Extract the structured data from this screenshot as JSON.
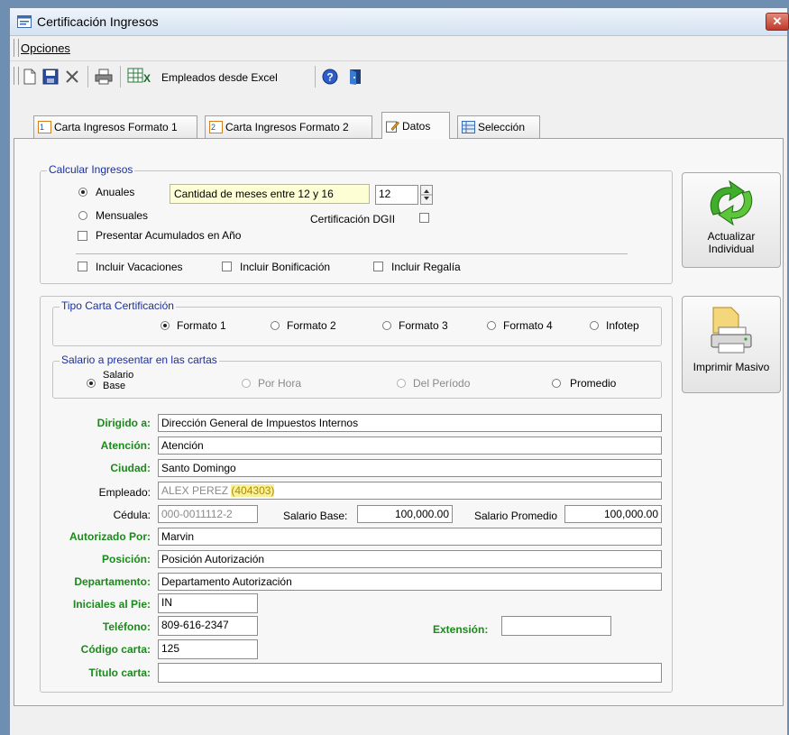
{
  "window": {
    "title": "Certificación Ingresos"
  },
  "menu": {
    "opciones": "Opciones"
  },
  "toolbar": {
    "excel_label": "Empleados desde Excel"
  },
  "tabs": [
    {
      "label": "Carta Ingresos Formato 1"
    },
    {
      "label": "Carta Ingresos Formato 2"
    },
    {
      "label": "Datos",
      "active": true
    },
    {
      "label": "Selección"
    }
  ],
  "calcular": {
    "legend": "Calcular Ingresos",
    "anuales": "Anuales",
    "mensuales": "Mensuales",
    "hint": "Cantidad de meses entre 12 y 16",
    "meses": "12",
    "dgii": "Certificación DGII",
    "acumulados": "Presentar Acumulados en Año",
    "vacaciones": "Incluir Vacaciones",
    "bonificacion": "Incluir Bonificación",
    "regalia": "Incluir Regalía"
  },
  "tipo": {
    "legend": "Tipo Carta Certificación",
    "f1": "Formato 1",
    "f2": "Formato 2",
    "f3": "Formato 3",
    "f4": "Formato 4",
    "infotep": "Infotep",
    "selected": "Formato 1"
  },
  "salario": {
    "legend": "Salario a presentar en las cartas",
    "base_l1": "Salario",
    "base_l2": "Base",
    "hora": "Por Hora",
    "periodo": "Del Período",
    "promedio": "Promedio",
    "selected": "Salario Base"
  },
  "fields": {
    "dirigido_label": "Dirigido a:",
    "dirigido": "Dirección General de Impuestos Internos",
    "atencion_label": "Atención:",
    "atencion": "Atención",
    "ciudad_label": "Ciudad:",
    "ciudad": "Santo Domingo",
    "empleado_label": "Empleado:",
    "empleado_name": "ALEX PEREZ ",
    "empleado_code": "(404303)",
    "cedula_label": "Cédula:",
    "cedula": "000-0011112-2",
    "salario_base_label": "Salario Base:",
    "salario_base": "100,000.00",
    "salario_prom_label": "Salario Promedio",
    "salario_prom": "100,000.00",
    "autorizado_label": "Autorizado Por:",
    "autorizado": "Marvin",
    "posicion_label": "Posición:",
    "posicion": "Posición Autorización",
    "departamento_label": "Departamento:",
    "departamento": "Departamento Autorización",
    "iniciales_label": "Iniciales al Pie:",
    "iniciales": "IN",
    "telefono_label": "Teléfono:",
    "telefono": "809-616-2347",
    "extension_label": "Extensión:",
    "extension": "",
    "codigo_label": "Código carta:",
    "codigo": "125",
    "titulo_label": "Título carta:",
    "titulo": ""
  },
  "buttons": {
    "actualizar_l1": "Actualizar",
    "actualizar_l2": "Individual",
    "imprimir": "Imprimir Masivo"
  },
  "colors": {
    "legend": "#1a2fa0",
    "field_label": "#1a8a1a",
    "hint_bg": "#fefed4",
    "close": "#c0392b"
  }
}
